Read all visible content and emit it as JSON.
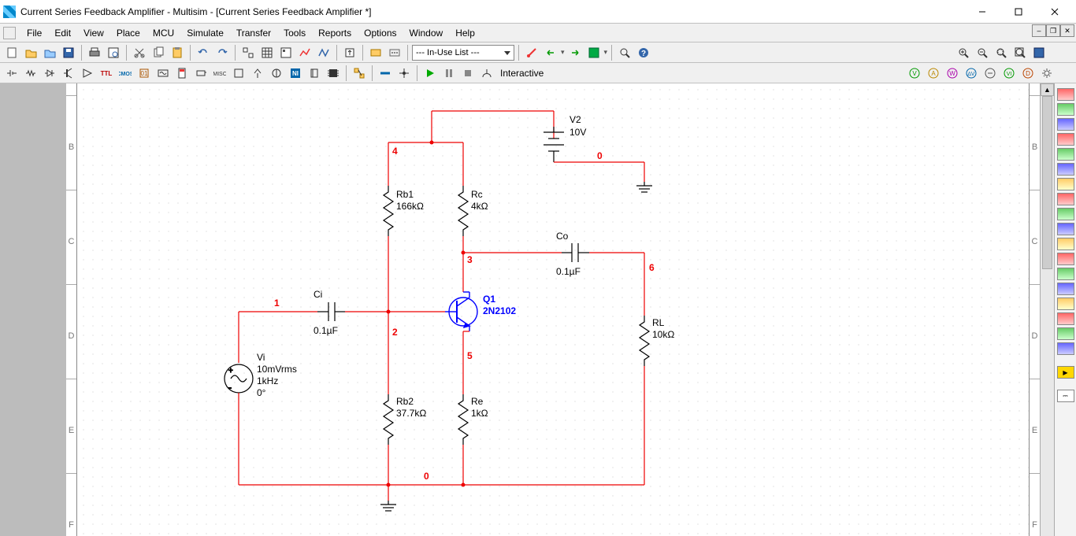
{
  "window": {
    "title": "Current Series Feedback Amplifier - Multisim - [Current Series Feedback Amplifier *]"
  },
  "menu": {
    "file": "File",
    "edit": "Edit",
    "view": "View",
    "place": "Place",
    "mcu": "MCU",
    "simulate": "Simulate",
    "transfer": "Transfer",
    "tools": "Tools",
    "reports": "Reports",
    "options": "Options",
    "window": "Window",
    "help": "Help"
  },
  "toolbar": {
    "inuse_list": "--- In-Use List ---",
    "interactive": "Interactive"
  },
  "rulers": {
    "B": "B",
    "C": "C",
    "D": "D",
    "E": "E",
    "F": "F"
  },
  "schematic": {
    "nets": {
      "n0a": "0",
      "n0b": "0",
      "n1": "1",
      "n2": "2",
      "n3": "3",
      "n4": "4",
      "n5": "5",
      "n6": "6"
    },
    "V2": {
      "name": "V2",
      "value": "10V"
    },
    "Vi": {
      "name": "Vi",
      "l1": "10mVrms",
      "l2": "1kHz",
      "l3": "0°"
    },
    "Ci": {
      "name": "Ci",
      "value": "0.1µF"
    },
    "Co": {
      "name": "Co",
      "value": "0.1µF"
    },
    "Rb1": {
      "name": "Rb1",
      "value": "166kΩ"
    },
    "Rc": {
      "name": "Rc",
      "value": "4kΩ"
    },
    "Rb2": {
      "name": "Rb2",
      "value": "37.7kΩ"
    },
    "Re": {
      "name": "Re",
      "value": "1kΩ"
    },
    "RL": {
      "name": "RL",
      "value": "10kΩ"
    },
    "Q1": {
      "name": "Q1",
      "part": "2N2102"
    }
  }
}
